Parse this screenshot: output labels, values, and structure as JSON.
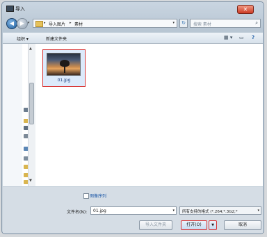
{
  "window": {
    "title": "导入",
    "close_label": "✕"
  },
  "nav": {
    "back": "◀",
    "forward": "▶",
    "breadcrumbs": [
      "导入图片",
      "素材"
    ],
    "refresh": "↻",
    "search_placeholder": "搜索 素材"
  },
  "toolbar": {
    "organize": "组织 ▾",
    "new_folder": "新建文件夹",
    "view_icon": "▦ ▾",
    "pane_icon": "▭",
    "help_icon": "?"
  },
  "files": [
    {
      "name": "01.jpg",
      "selected": true
    }
  ],
  "options": {
    "sequence_label": "图像序列"
  },
  "footer": {
    "filename_label": "文件名(N):",
    "filename_value": "01.jpg",
    "filter_value": "所有支持的格式 (*.264;*.3G2;*",
    "import_folder": "导入文件夹",
    "open": "打开(O)",
    "cancel": "取消"
  }
}
